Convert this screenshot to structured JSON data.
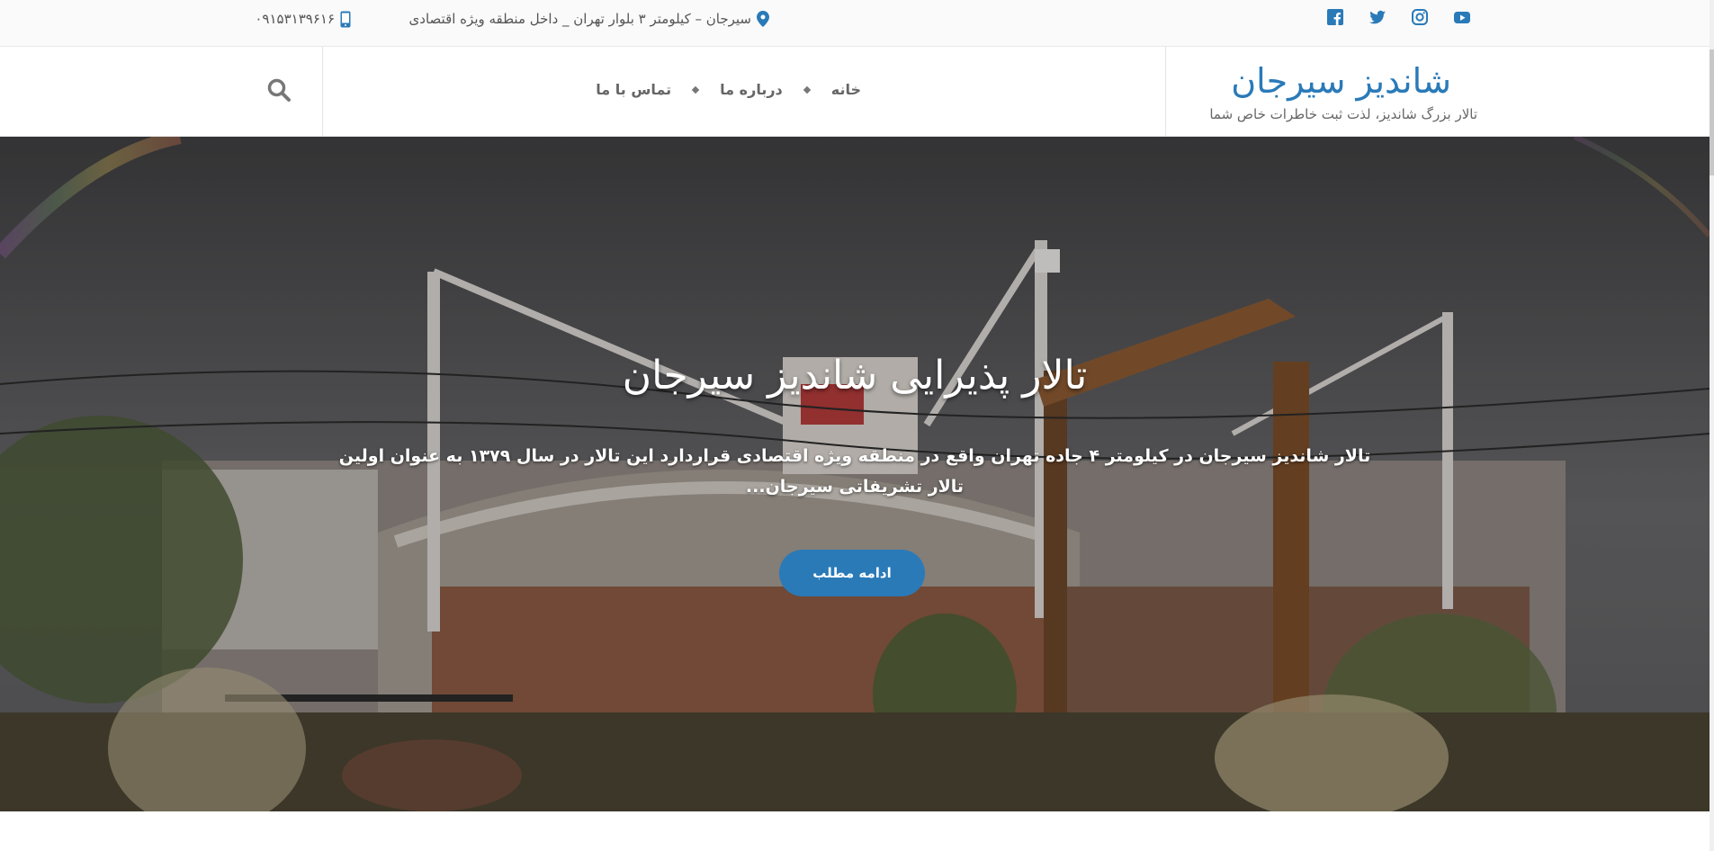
{
  "topbar": {
    "address": "سیرجان – کیلومتر ۳ بلوار تهران _ داخل منطقه ویژه اقتصادی",
    "address_icon": "map-marker-icon",
    "phone": "۰۹۱۵۳۱۳۹۶۱۶",
    "phone_icon": "mobile-phone-icon",
    "socials": [
      "facebook-icon",
      "twitter-icon",
      "instagram-icon",
      "youtube-icon"
    ]
  },
  "header": {
    "site_title": "شاندیز سیرجان",
    "tagline": "تالار بزرگ شاندیز، لذت ثبت خاطرات خاص شما",
    "nav": [
      "خانه",
      "درباره ما",
      "تماس با ما"
    ],
    "search_icon": "search-icon"
  },
  "hero": {
    "title": "تالار پذیرایی شاندیز سیرجان",
    "text": "تالار شاندیز سیرجان در کیلومتر ۴ جاده تهران واقع در منطقه ویژه اقتصادی قراردارد این تالار در سال ۱۳۷۹ به عنوان اولین تالار تشریفاتی سیرجان...",
    "button": "ادامه مطلب"
  },
  "colors": {
    "accent": "#2a7ab8",
    "topbar_bg": "#fafafa"
  }
}
